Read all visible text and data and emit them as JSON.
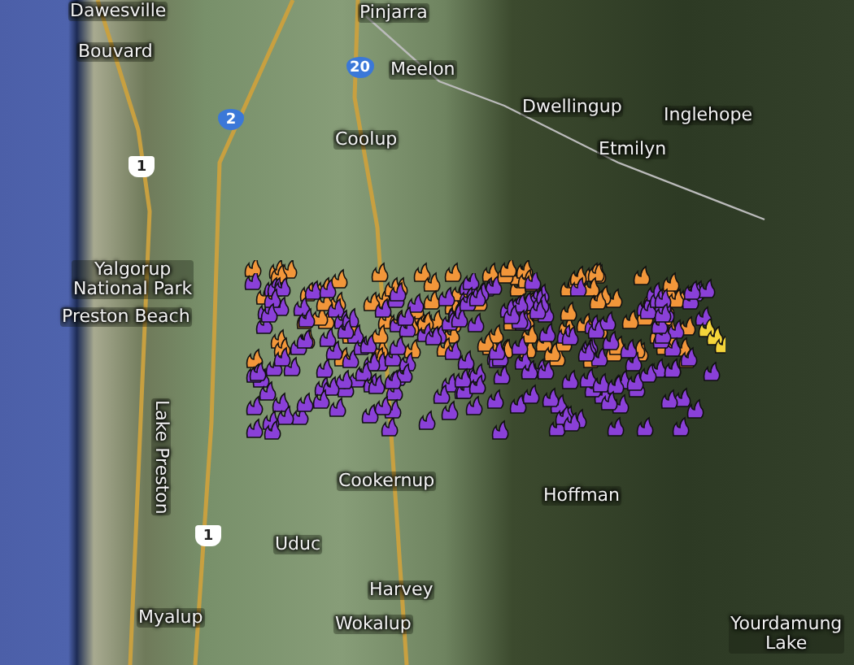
{
  "map": {
    "places": [
      {
        "name": "Dawesville"
      },
      {
        "name": "Pinjarra"
      },
      {
        "name": "Bouvard"
      },
      {
        "name": "Meelon"
      },
      {
        "name": "Dwellingup"
      },
      {
        "name": "Inglehope"
      },
      {
        "name": "Coolup"
      },
      {
        "name": "Etmilyn"
      },
      {
        "name": "Yalgorup\nNational Park"
      },
      {
        "name": "Preston Beach"
      },
      {
        "name": "Cookernup"
      },
      {
        "name": "Hoffman"
      },
      {
        "name": "Uduc"
      },
      {
        "name": "Harvey"
      },
      {
        "name": "Myalup"
      },
      {
        "name": "Wokalup"
      },
      {
        "name": "Yourdamung\nLake"
      }
    ],
    "vertical_places": [
      {
        "name": "Lake Preston"
      }
    ],
    "road_shields": [
      {
        "number": "2",
        "kind": "state"
      },
      {
        "number": "20",
        "kind": "state"
      },
      {
        "number": "1",
        "kind": "national"
      },
      {
        "number": "1",
        "kind": "national"
      }
    ],
    "marker_groups": [
      {
        "color": "#f2963a"
      },
      {
        "color": "#8a40d8"
      },
      {
        "color": "#f4d43a"
      }
    ]
  }
}
